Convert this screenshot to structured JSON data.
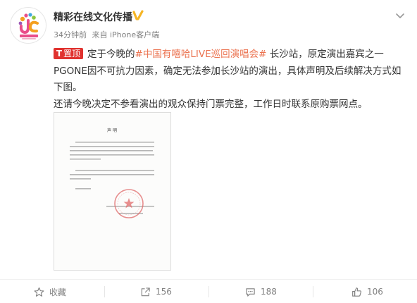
{
  "account": {
    "name": "精彩在线文化传播",
    "time": "34分钟前",
    "source": "来自 iPhone客户端"
  },
  "post": {
    "pin_label": "置顶",
    "pin_glyph": "T",
    "text_before": "定于今晚的",
    "topic": "#中国有嘻哈LIVE巡回演唱会#",
    "text_after": " 长沙站，原定演出嘉宾之一PGONE因不可抗力因素，确定无法参加长沙站的演出，具体声明及后续解决方式如下图。",
    "paragraph2": "还请今晚决定不参看演出的观众保持门票完整，工作日时联系原购票网点。"
  },
  "document": {
    "title": "声 明",
    "paragraph1": "关于2018年1月4日在湖南国际会展中心举办中国有嘻哈LIVE巡回演唱会长沙站，原定演出嘉宾之一PGONE因不可抗力因素，确定无法参加长沙站的演出。",
    "paragraph2": "因此，我们向广大观众致歉，如有需要退票的观众请保持门票完整，工作日时联系原购票网点办理退票手续。",
    "signature": "特此声明",
    "stamp_text": "精彩在线文化传播有限公司"
  },
  "actions": {
    "favorite_label": "收藏",
    "repost_count": "156",
    "comment_count": "188",
    "like_count": "106"
  },
  "colors": {
    "accent": "#eb7350",
    "pin": "#e0322f",
    "verified": "#f6b524",
    "muted": "#808080"
  },
  "icons": [
    "verified-badge-icon",
    "chevron-down-icon",
    "star-icon",
    "repost-icon",
    "comment-icon",
    "thumbs-up-icon"
  ]
}
